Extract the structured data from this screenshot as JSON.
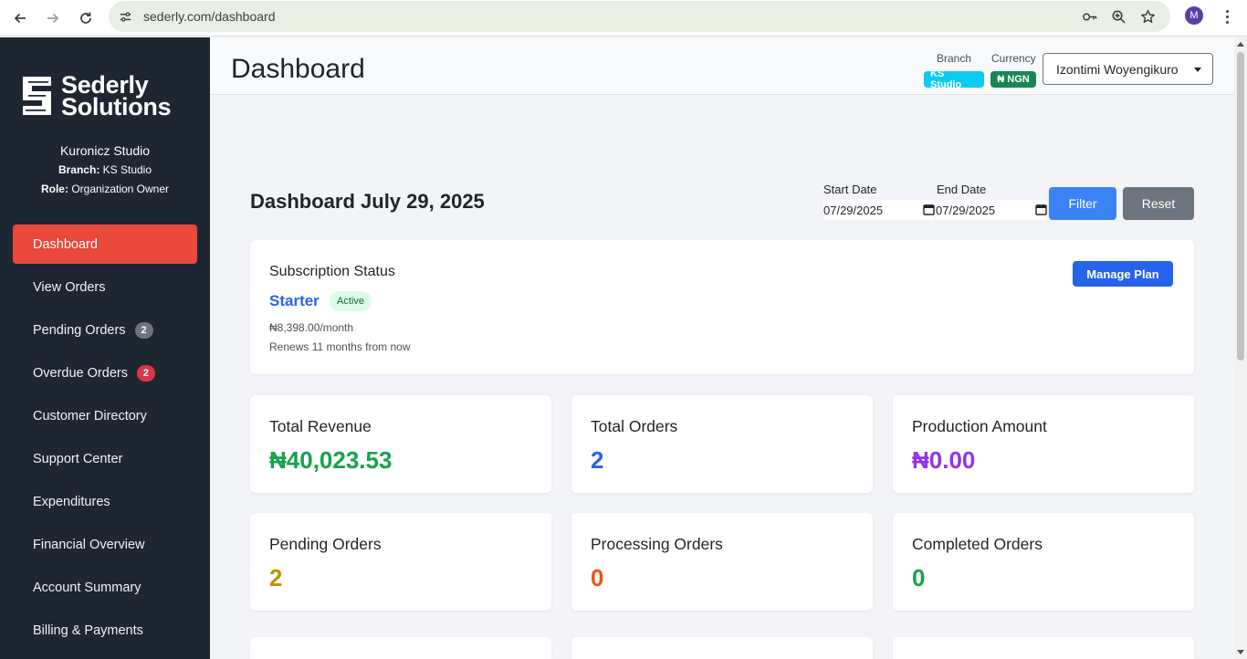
{
  "browser": {
    "url": "sederly.com/dashboard",
    "profile_initial": "M"
  },
  "brand": {
    "line1": "Sederly",
    "line2": "Solutions"
  },
  "org": {
    "name": "Kuronicz Studio",
    "branch_label": "Branch:",
    "branch_value": "KS Studio",
    "role_label": "Role:",
    "role_value": "Organization Owner"
  },
  "sidebar": {
    "items": [
      {
        "label": "Dashboard",
        "active": true
      },
      {
        "label": "View Orders"
      },
      {
        "label": "Pending Orders",
        "badge": "2"
      },
      {
        "label": "Overdue Orders",
        "badge": "2"
      },
      {
        "label": "Customer Directory"
      },
      {
        "label": "Support Center"
      },
      {
        "label": "Expenditures"
      },
      {
        "label": "Financial Overview"
      },
      {
        "label": "Account Summary"
      },
      {
        "label": "Billing & Payments"
      }
    ]
  },
  "header": {
    "title": "Dashboard",
    "branch_label": "Branch",
    "branch_value": "KS Studio",
    "currency_label": "Currency",
    "currency_value": "₦ NGN",
    "user_name": "Izontimi Woyengikuro"
  },
  "dashboard": {
    "title": "Dashboard July 29, 2025",
    "start_label": "Start Date",
    "start_value": "07/29/2025",
    "end_label": "End Date",
    "end_value": "07/29/2025",
    "filter_label": "Filter",
    "reset_label": "Reset"
  },
  "subscription": {
    "heading": "Subscription Status",
    "plan": "Starter",
    "status": "Active",
    "price": "₦8,398.00/month",
    "renewal": "Renews 11 months from now",
    "manage_label": "Manage Plan"
  },
  "stats": [
    {
      "label": "Total Revenue",
      "value": "₦40,023.53",
      "color": "#16a34a"
    },
    {
      "label": "Total Orders",
      "value": "2",
      "color": "#2563eb"
    },
    {
      "label": "Production Amount",
      "value": "₦0.00",
      "color": "#9333ea"
    },
    {
      "label": "Pending Orders",
      "value": "2",
      "color": "#ca8a04"
    },
    {
      "label": "Processing Orders",
      "value": "0",
      "color": "#ea580c"
    },
    {
      "label": "Completed Orders",
      "value": "0",
      "color": "#16a34a"
    }
  ],
  "colors": {
    "sidebar_bg": "#1e2632",
    "active_item": "#e9483b",
    "primary_button": "#3b82f6",
    "secondary_button": "#6c757d",
    "branch_pill": "#0dcaf0",
    "currency_pill": "#198754"
  }
}
